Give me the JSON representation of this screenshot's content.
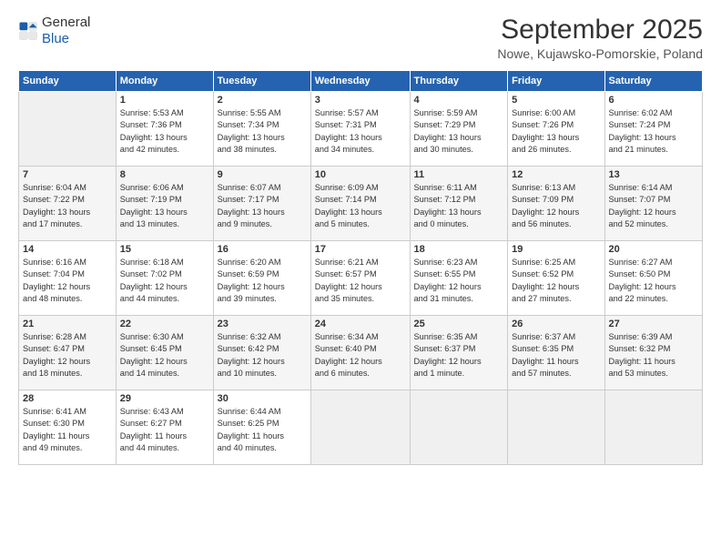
{
  "header": {
    "logo_line1": "General",
    "logo_line2": "Blue",
    "month_title": "September 2025",
    "location": "Nowe, Kujawsko-Pomorskie, Poland"
  },
  "days_of_week": [
    "Sunday",
    "Monday",
    "Tuesday",
    "Wednesday",
    "Thursday",
    "Friday",
    "Saturday"
  ],
  "weeks": [
    [
      {
        "day": "",
        "info": ""
      },
      {
        "day": "1",
        "info": "Sunrise: 5:53 AM\nSunset: 7:36 PM\nDaylight: 13 hours\nand 42 minutes."
      },
      {
        "day": "2",
        "info": "Sunrise: 5:55 AM\nSunset: 7:34 PM\nDaylight: 13 hours\nand 38 minutes."
      },
      {
        "day": "3",
        "info": "Sunrise: 5:57 AM\nSunset: 7:31 PM\nDaylight: 13 hours\nand 34 minutes."
      },
      {
        "day": "4",
        "info": "Sunrise: 5:59 AM\nSunset: 7:29 PM\nDaylight: 13 hours\nand 30 minutes."
      },
      {
        "day": "5",
        "info": "Sunrise: 6:00 AM\nSunset: 7:26 PM\nDaylight: 13 hours\nand 26 minutes."
      },
      {
        "day": "6",
        "info": "Sunrise: 6:02 AM\nSunset: 7:24 PM\nDaylight: 13 hours\nand 21 minutes."
      }
    ],
    [
      {
        "day": "7",
        "info": "Sunrise: 6:04 AM\nSunset: 7:22 PM\nDaylight: 13 hours\nand 17 minutes."
      },
      {
        "day": "8",
        "info": "Sunrise: 6:06 AM\nSunset: 7:19 PM\nDaylight: 13 hours\nand 13 minutes."
      },
      {
        "day": "9",
        "info": "Sunrise: 6:07 AM\nSunset: 7:17 PM\nDaylight: 13 hours\nand 9 minutes."
      },
      {
        "day": "10",
        "info": "Sunrise: 6:09 AM\nSunset: 7:14 PM\nDaylight: 13 hours\nand 5 minutes."
      },
      {
        "day": "11",
        "info": "Sunrise: 6:11 AM\nSunset: 7:12 PM\nDaylight: 13 hours\nand 0 minutes."
      },
      {
        "day": "12",
        "info": "Sunrise: 6:13 AM\nSunset: 7:09 PM\nDaylight: 12 hours\nand 56 minutes."
      },
      {
        "day": "13",
        "info": "Sunrise: 6:14 AM\nSunset: 7:07 PM\nDaylight: 12 hours\nand 52 minutes."
      }
    ],
    [
      {
        "day": "14",
        "info": "Sunrise: 6:16 AM\nSunset: 7:04 PM\nDaylight: 12 hours\nand 48 minutes."
      },
      {
        "day": "15",
        "info": "Sunrise: 6:18 AM\nSunset: 7:02 PM\nDaylight: 12 hours\nand 44 minutes."
      },
      {
        "day": "16",
        "info": "Sunrise: 6:20 AM\nSunset: 6:59 PM\nDaylight: 12 hours\nand 39 minutes."
      },
      {
        "day": "17",
        "info": "Sunrise: 6:21 AM\nSunset: 6:57 PM\nDaylight: 12 hours\nand 35 minutes."
      },
      {
        "day": "18",
        "info": "Sunrise: 6:23 AM\nSunset: 6:55 PM\nDaylight: 12 hours\nand 31 minutes."
      },
      {
        "day": "19",
        "info": "Sunrise: 6:25 AM\nSunset: 6:52 PM\nDaylight: 12 hours\nand 27 minutes."
      },
      {
        "day": "20",
        "info": "Sunrise: 6:27 AM\nSunset: 6:50 PM\nDaylight: 12 hours\nand 22 minutes."
      }
    ],
    [
      {
        "day": "21",
        "info": "Sunrise: 6:28 AM\nSunset: 6:47 PM\nDaylight: 12 hours\nand 18 minutes."
      },
      {
        "day": "22",
        "info": "Sunrise: 6:30 AM\nSunset: 6:45 PM\nDaylight: 12 hours\nand 14 minutes."
      },
      {
        "day": "23",
        "info": "Sunrise: 6:32 AM\nSunset: 6:42 PM\nDaylight: 12 hours\nand 10 minutes."
      },
      {
        "day": "24",
        "info": "Sunrise: 6:34 AM\nSunset: 6:40 PM\nDaylight: 12 hours\nand 6 minutes."
      },
      {
        "day": "25",
        "info": "Sunrise: 6:35 AM\nSunset: 6:37 PM\nDaylight: 12 hours\nand 1 minute."
      },
      {
        "day": "26",
        "info": "Sunrise: 6:37 AM\nSunset: 6:35 PM\nDaylight: 11 hours\nand 57 minutes."
      },
      {
        "day": "27",
        "info": "Sunrise: 6:39 AM\nSunset: 6:32 PM\nDaylight: 11 hours\nand 53 minutes."
      }
    ],
    [
      {
        "day": "28",
        "info": "Sunrise: 6:41 AM\nSunset: 6:30 PM\nDaylight: 11 hours\nand 49 minutes."
      },
      {
        "day": "29",
        "info": "Sunrise: 6:43 AM\nSunset: 6:27 PM\nDaylight: 11 hours\nand 44 minutes."
      },
      {
        "day": "30",
        "info": "Sunrise: 6:44 AM\nSunset: 6:25 PM\nDaylight: 11 hours\nand 40 minutes."
      },
      {
        "day": "",
        "info": ""
      },
      {
        "day": "",
        "info": ""
      },
      {
        "day": "",
        "info": ""
      },
      {
        "day": "",
        "info": ""
      }
    ]
  ]
}
